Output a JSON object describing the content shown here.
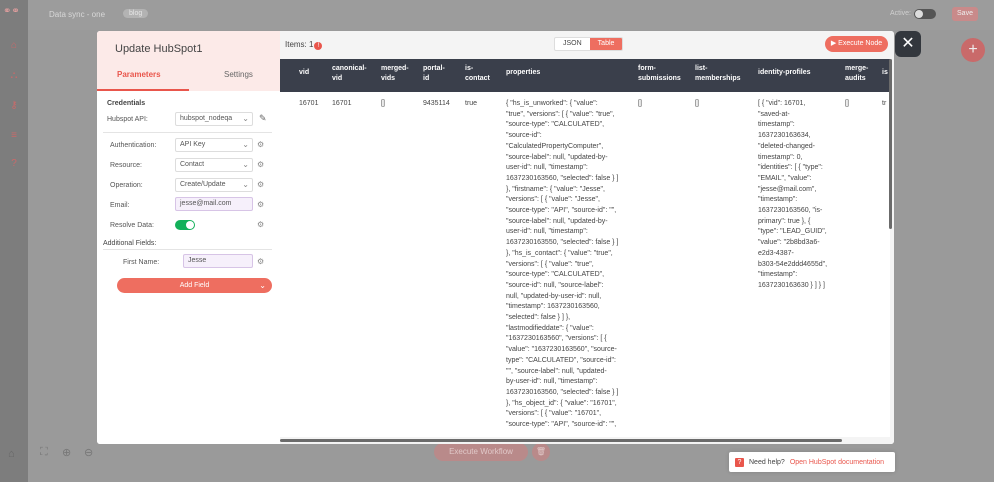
{
  "app": {
    "workflow_title": "Data sync - one",
    "tag": "blog",
    "active_label": "Active:",
    "save_label": "Save",
    "execute_workflow_label": "Execute Workflow"
  },
  "help": {
    "prefix": "Need help?",
    "link": "Open HubSpot documentation"
  },
  "node": {
    "title": "Update HubSpot1",
    "tabs": [
      "Parameters",
      "Settings"
    ],
    "credentials_heading": "Credentials",
    "hubspot_api_label": "Hubspot API:",
    "hubspot_api_value": "hubspot_nodeqa",
    "fields": [
      {
        "label": "Authentication:",
        "value": "API Key"
      },
      {
        "label": "Resource:",
        "value": "Contact"
      },
      {
        "label": "Operation:",
        "value": "Create/Update"
      },
      {
        "label": "Email:",
        "value": "jesse@mail.com"
      },
      {
        "label": "Resolve Data:",
        "value": ""
      }
    ],
    "additional_fields_heading": "Additional Fields:",
    "first_name_label": "First Name:",
    "first_name_value": "Jesse",
    "add_field_label": "Add Field"
  },
  "output": {
    "items_label": "Items: 1",
    "view_options": [
      "JSON",
      "Table"
    ],
    "active_view": "Table",
    "execute_node_label": "Execute Node",
    "columns": [
      "vid",
      "canonical-\nvid",
      "merged-\nvids",
      "portal-\nid",
      "is-\ncontact",
      "properties",
      "form-\nsubmissions",
      "list-\nmemberships",
      "identity-profiles",
      "merge-\naudits",
      "is"
    ],
    "row": {
      "vid": "16701",
      "canonical_vid": "16701",
      "merged_vids": "[]",
      "portal_id": "9435114",
      "is_contact": "true",
      "properties": "{ \"hs_is_unworked\": { \"value\":\n\"true\", \"versions\": [ { \"value\": \"true\",\n\"source-type\": \"CALCULATED\",\n\"source-id\":\n\"CalculatedPropertyComputer\",\n\"source-label\": null, \"updated-by-\nuser-id\": null, \"timestamp\":\n1637230163560, \"selected\": false } ]\n}, \"firstname\": { \"value\": \"Jesse\",\n\"versions\": [ { \"value\": \"Jesse\",\n\"source-type\": \"API\", \"source-id\": \"\",\n\"source-label\": null, \"updated-by-\nuser-id\": null, \"timestamp\":\n1637230163550, \"selected\": false } ]\n}, \"hs_is_contact\": { \"value\": \"true\",\n\"versions\": [ { \"value\": \"true\",\n\"source-type\": \"CALCULATED\",\n\"source-id\": null, \"source-label\":\nnull, \"updated-by-user-id\": null,\n\"timestamp\": 1637230163560,\n\"selected\": false } ] },\n\"lastmodifieddate\": { \"value\":\n\"1637230163560\", \"versions\": [ {\n\"value\": \"1637230163560\", \"source-\ntype\": \"CALCULATED\", \"source-id\":\n\"\", \"source-label\": null, \"updated-\nby-user-id\": null, \"timestamp\":\n1637230163560, \"selected\": false } ]\n}, \"hs_object_id\": { \"value\": \"16701\",\n\"versions\": [ { \"value\": \"16701\",\n\"source-type\": \"API\", \"source-id\": \"\",",
      "form_submissions": "[]",
      "list_memberships": "[]",
      "identity_profiles": "[ { \"vid\": 16701,\n\"saved-at-\ntimestamp\":\n1637230163634,\n\"deleted-changed-\ntimestamp\": 0,\n\"identities\": [ { \"type\":\n\"EMAIL\", \"value\":\n\"jesse@mail.com\",\n\"timestamp\":\n1637230163560, \"is-\nprimary\": true }, {\n\"type\": \"LEAD_GUID\",\n\"value\": \"2b8bd3a6-\ne2d3-4387-\nb303-54e2ddd4655d\",\n\"timestamp\":\n1637230163630 } ] } ]",
      "merge_audits": "[]",
      "is_partial": "tr"
    }
  },
  "icons": {
    "close": "close-icon",
    "gear": "gear-icon",
    "pencil": "pencil-icon",
    "warning": "warning-icon"
  },
  "colors": {
    "accent": "#e9564c",
    "table_header": "#3a3f4b",
    "toggle_on": "#13b05a"
  }
}
